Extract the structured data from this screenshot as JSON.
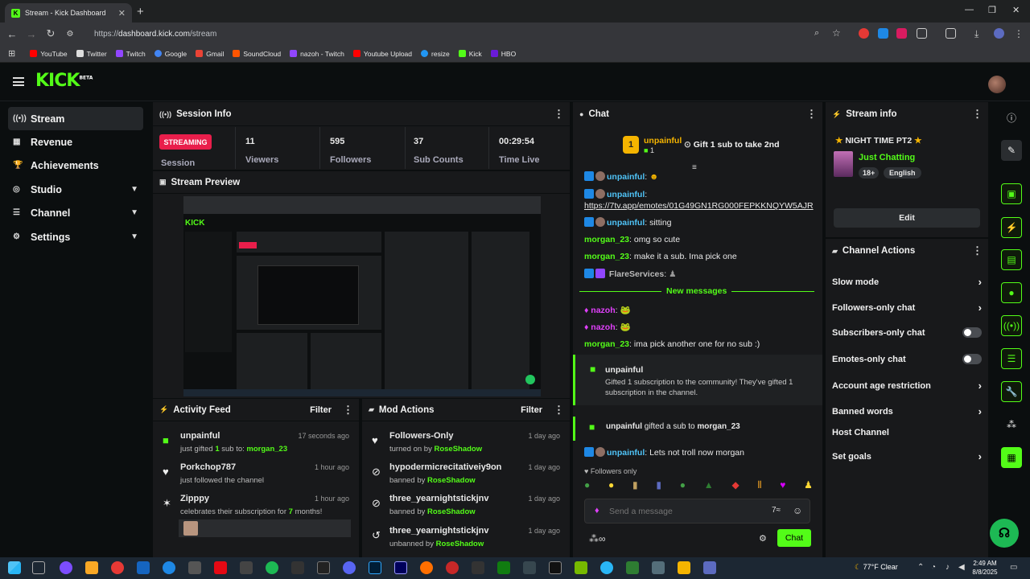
{
  "browser": {
    "tab_title": "Stream - Kick Dashboard",
    "url_scheme": "https://",
    "url_host": "dashboard.kick.com",
    "url_path": "/stream",
    "bookmarks": [
      {
        "label": "YouTube",
        "color": "#ff0000"
      },
      {
        "label": "Twitter",
        "color": "#dddddd"
      },
      {
        "label": "Twitch",
        "color": "#9146ff"
      },
      {
        "label": "Google",
        "color": "#4285f4"
      },
      {
        "label": "Gmail",
        "color": "#ea4335"
      },
      {
        "label": "SoundCloud",
        "color": "#ff5500"
      },
      {
        "label": "nazoh - Twitch",
        "color": "#9146ff"
      },
      {
        "label": "Youtube Upload",
        "color": "#ff0000"
      },
      {
        "label": "resize",
        "color": "#2196f3"
      },
      {
        "label": "Kick",
        "color": "#53fc18"
      },
      {
        "label": "HBO",
        "color": "#6a1bd9"
      }
    ]
  },
  "header": {
    "logo": "KICK",
    "logo_tag": "BETA"
  },
  "nav": [
    {
      "label": "Stream",
      "icon": "broadcast-icon",
      "selected": true
    },
    {
      "label": "Revenue",
      "icon": "chart-icon"
    },
    {
      "label": "Achievements",
      "icon": "trophy-icon"
    },
    {
      "label": "Studio",
      "icon": "camera-icon",
      "expandable": true
    },
    {
      "label": "Channel",
      "icon": "user-icon",
      "expandable": true
    },
    {
      "label": "Settings",
      "icon": "gear-icon",
      "expandable": true
    }
  ],
  "session": {
    "title": "Session Info",
    "status": "STREAMING",
    "status_label": "Session",
    "stats": [
      {
        "value": "11",
        "label": "Viewers"
      },
      {
        "value": "595",
        "label": "Followers"
      },
      {
        "value": "37",
        "label": "Sub Counts"
      },
      {
        "value": "00:29:54",
        "label": "Time Live"
      }
    ]
  },
  "preview": {
    "title": "Stream Preview"
  },
  "activity": {
    "title": "Activity Feed",
    "filter": "Filter",
    "items": [
      {
        "user": "unpainful",
        "text_a": "just gifted ",
        "count": "1",
        "text_b": " sub to: ",
        "target": "morgan_23",
        "time": "17 seconds ago"
      },
      {
        "user": "Porkchop787",
        "text": "just followed the channel",
        "time": "1 hour ago"
      },
      {
        "user": "Zipppy",
        "text_a": "celebrates their subscription for ",
        "count": "7",
        "text_b": " months!",
        "time": "1 hour ago"
      }
    ]
  },
  "mod": {
    "title": "Mod Actions",
    "filter": "Filter",
    "items": [
      {
        "action": "Followers-Only",
        "verb": "turned on by ",
        "by": "RoseShadow",
        "time": "1 day ago"
      },
      {
        "action": "hypodermicrecitativeiy9on",
        "verb": "banned by ",
        "by": "RoseShadow",
        "time": "1 day ago"
      },
      {
        "action": "three_yearnightstickjnv",
        "verb": "banned by ",
        "by": "RoseShadow",
        "time": "1 day ago"
      },
      {
        "action": "three_yearnightstickjnv",
        "verb": "unbanned by ",
        "by": "RoseShadow",
        "time": "1 day ago"
      }
    ]
  },
  "chat": {
    "title": "Chat",
    "pinned_user": "unpainful",
    "pinned_count": "1",
    "pinned_rank": "1",
    "goal": "Gift 1 sub to take 2nd",
    "messages": [
      {
        "user": "unpainful",
        "text": ""
      },
      {
        "user": "unpainful",
        "text": ""
      },
      {
        "link": "https://7tv.app/emotes/01G49GN1RG000FEPKKNQYW5AJR"
      },
      {
        "user": "unpainful",
        "text": " sitting"
      },
      {
        "user": "morgan_23",
        "text": " omg so cute"
      },
      {
        "user": "morgan_23",
        "text": " make it a sub. Ima pick one"
      },
      {
        "user": "FlareServices",
        "text": ""
      }
    ],
    "new_messages": "New messages",
    "messages2": [
      {
        "user": "nazoh"
      },
      {
        "user": "nazoh"
      },
      {
        "user": "morgan_23",
        "text": " ima pick another one for no sub :)"
      }
    ],
    "gift_user": "unpainful",
    "gift_text": "Gifted 1 subscription to the community! They've gifted 1 subscription in the channel.",
    "gifted_user": "unpainful",
    "gifted_mid": " gifted a sub to ",
    "gifted_target": "morgan_23",
    "last_user": "unpainful",
    "last_text": " Lets not troll now morgan",
    "followers_only": "Followers only",
    "placeholder": "Send a message",
    "send": "Chat"
  },
  "stream_info": {
    "title": "Stream info",
    "stream_title": "NIGHT TIME PT2",
    "category": "Just Chatting",
    "tags": [
      "18+",
      "English"
    ],
    "edit": "Edit"
  },
  "channel_actions": {
    "title": "Channel Actions",
    "items": [
      {
        "label": "Slow mode",
        "type": "arrow"
      },
      {
        "label": "Followers-only chat",
        "type": "arrow"
      },
      {
        "label": "Subscribers-only chat",
        "type": "toggle"
      },
      {
        "label": "Emotes-only chat",
        "type": "toggle"
      },
      {
        "label": "Account age restriction",
        "type": "arrow"
      },
      {
        "label": "Banned words",
        "type": "arrow"
      },
      {
        "label": "Host Channel",
        "type": "none"
      },
      {
        "label": "Set goals",
        "type": "arrow"
      }
    ]
  },
  "taskbar": {
    "weather": "77°F  Clear",
    "time": "2:49 AM",
    "date": "8/8/2025"
  }
}
